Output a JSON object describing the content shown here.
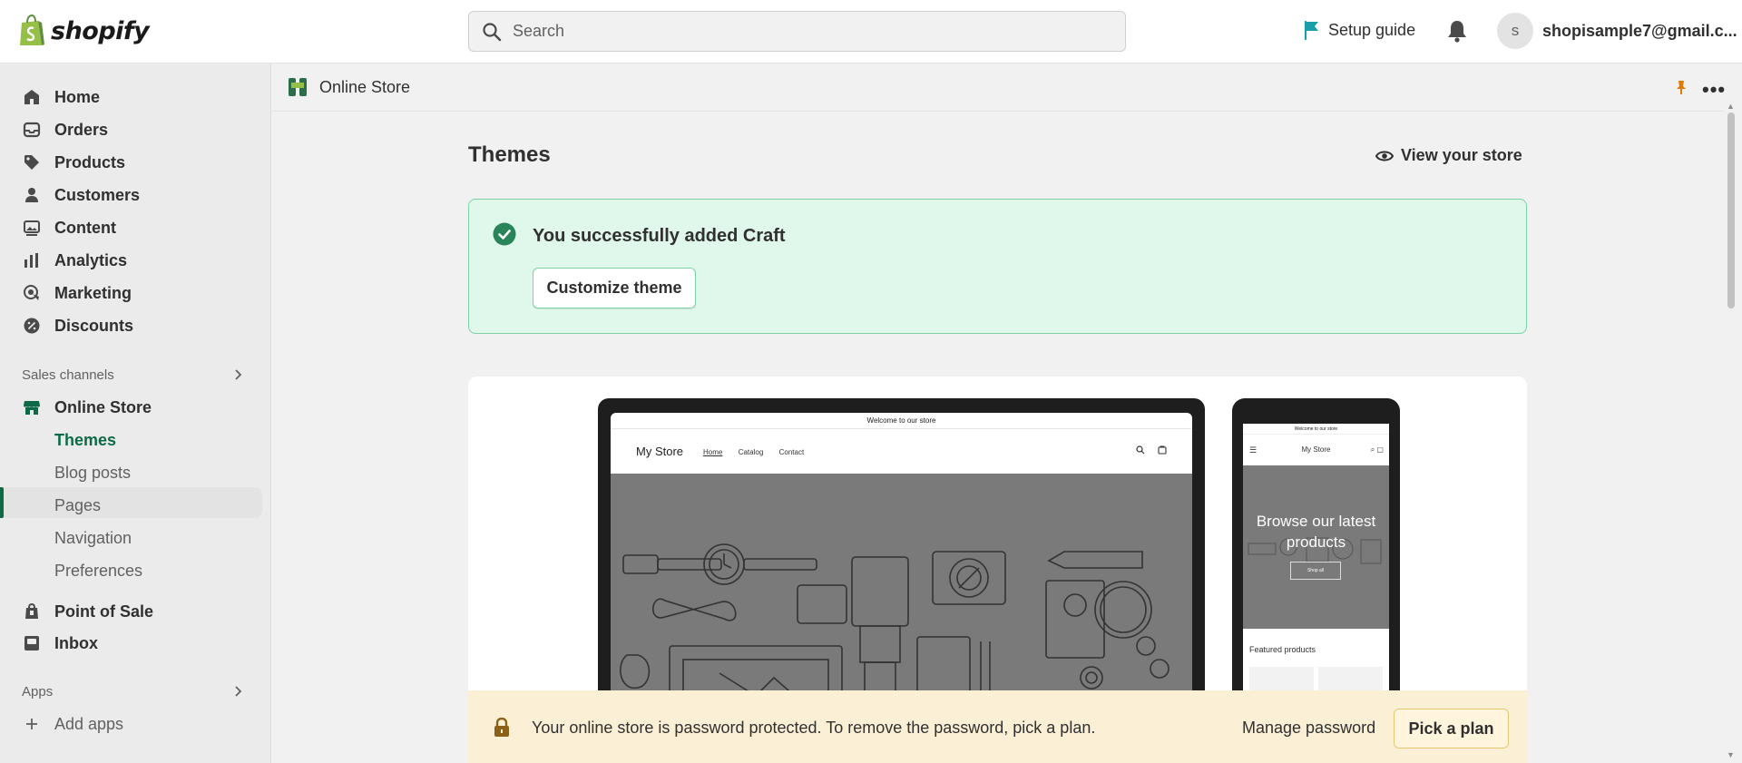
{
  "topbar": {
    "brand": "shopify",
    "search_placeholder": "Search",
    "setup_guide": "Setup guide",
    "avatar_initial": "s",
    "account_email": "shopisample7@gmail.c..."
  },
  "sidebar": {
    "items": [
      {
        "label": "Home",
        "icon": "home-icon"
      },
      {
        "label": "Orders",
        "icon": "inbox-tray-icon"
      },
      {
        "label": "Products",
        "icon": "tag-icon"
      },
      {
        "label": "Customers",
        "icon": "person-icon"
      },
      {
        "label": "Content",
        "icon": "image-icon"
      },
      {
        "label": "Analytics",
        "icon": "bar-chart-icon"
      },
      {
        "label": "Marketing",
        "icon": "target-icon"
      },
      {
        "label": "Discounts",
        "icon": "discount-icon"
      }
    ],
    "sales_channels_label": "Sales channels",
    "online_store": "Online Store",
    "online_store_subitems": [
      "Themes",
      "Blog posts",
      "Pages",
      "Navigation",
      "Preferences"
    ],
    "point_of_sale": "Point of Sale",
    "inbox": "Inbox",
    "apps_label": "Apps",
    "add_apps": "Add apps"
  },
  "app_header": {
    "title": "Online Store"
  },
  "page": {
    "title": "Themes",
    "view_store": "View your store"
  },
  "success_banner": {
    "message": "You successfully added Craft",
    "button": "Customize theme"
  },
  "preview": {
    "announcement": "Welcome to our store",
    "store_name": "My Store",
    "nav": [
      "Home",
      "Catalog",
      "Contact"
    ],
    "phone_hero_title": "Browse our latest products",
    "phone_hero_button": "Shop all",
    "featured": "Featured products"
  },
  "password_banner": {
    "message": "Your online store is password protected. To remove the password, pick a plan.",
    "manage": "Manage password",
    "button": "Pick a plan"
  },
  "colors": {
    "accent_green": "#0c6b46",
    "success_bg": "#e0f7ec",
    "warning_bg": "#fbf0d5"
  }
}
